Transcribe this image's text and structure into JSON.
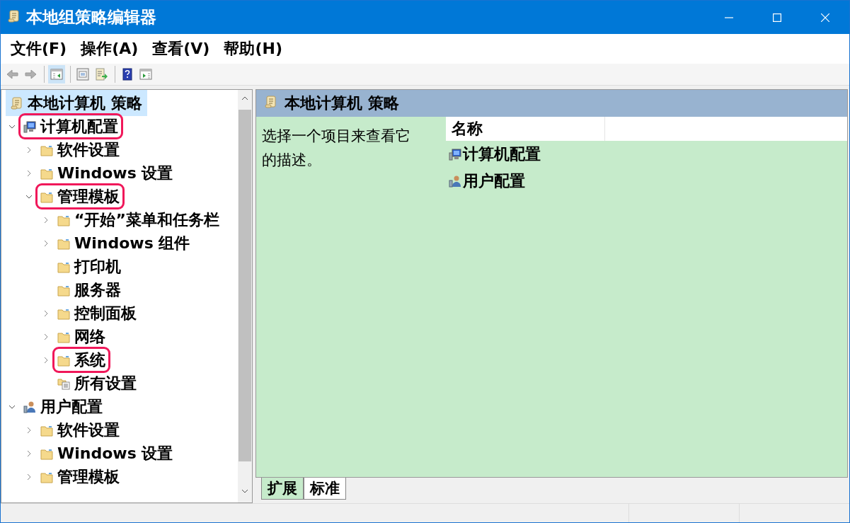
{
  "window": {
    "title": "本地组策略编辑器"
  },
  "menu": [
    "文件(F)",
    "操作(A)",
    "查看(V)",
    "帮助(H)"
  ],
  "toolbar": [
    {
      "kind": "back",
      "disabled": true
    },
    {
      "kind": "forward",
      "disabled": true
    },
    {
      "kind": "sep"
    },
    {
      "kind": "tree",
      "selected": true
    },
    {
      "kind": "sep"
    },
    {
      "kind": "properties",
      "selected": false
    },
    {
      "kind": "export",
      "selected": false
    },
    {
      "kind": "sep"
    },
    {
      "kind": "help",
      "selected": false
    },
    {
      "kind": "pane",
      "selected": false
    }
  ],
  "tree": [
    {
      "label": "本地计算机 策略",
      "kind": "root",
      "selected": true,
      "highlighted": false,
      "children": [
        {
          "label": "计算机配置",
          "kind": "computer",
          "selected": false,
          "highlighted": true,
          "expanded": true,
          "children": [
            {
              "label": "软件设置",
              "kind": "folder",
              "selected": false,
              "highlighted": false,
              "expanded": false
            },
            {
              "label": "Windows 设置",
              "kind": "folder",
              "selected": false,
              "highlighted": false,
              "expanded": false
            },
            {
              "label": "管理模板",
              "kind": "folder",
              "selected": false,
              "highlighted": true,
              "expanded": true,
              "children": [
                {
                  "label": "“开始”菜单和任务栏",
                  "kind": "folder",
                  "selected": false,
                  "highlighted": false,
                  "expanded": false
                },
                {
                  "label": "Windows 组件",
                  "kind": "folder",
                  "selected": false,
                  "highlighted": false,
                  "expanded": false
                },
                {
                  "label": "打印机",
                  "kind": "folder",
                  "selected": false,
                  "highlighted": false
                },
                {
                  "label": "服务器",
                  "kind": "folder",
                  "selected": false,
                  "highlighted": false
                },
                {
                  "label": "控制面板",
                  "kind": "folder",
                  "selected": false,
                  "highlighted": false,
                  "expanded": false
                },
                {
                  "label": "网络",
                  "kind": "folder",
                  "selected": false,
                  "highlighted": false,
                  "expanded": false
                },
                {
                  "label": "系统",
                  "kind": "folder",
                  "selected": false,
                  "highlighted": true,
                  "expanded": false
                },
                {
                  "label": "所有设置",
                  "kind": "settings",
                  "selected": false,
                  "highlighted": false
                }
              ]
            }
          ]
        },
        {
          "label": "用户配置",
          "kind": "user",
          "selected": false,
          "highlighted": false,
          "expanded": true,
          "children": [
            {
              "label": "软件设置",
              "kind": "folder",
              "selected": false,
              "highlighted": false,
              "expanded": false
            },
            {
              "label": "Windows 设置",
              "kind": "folder",
              "selected": false,
              "highlighted": false,
              "expanded": false
            },
            {
              "label": "管理模板",
              "kind": "folder",
              "selected": false,
              "highlighted": false,
              "expanded": false
            }
          ]
        }
      ]
    }
  ],
  "detail": {
    "title": "本地计算机 策略",
    "description": "选择一个项目来查看它的描述。",
    "columns": [
      "名称"
    ],
    "items": [
      {
        "label": "计算机配置",
        "kind": "computer"
      },
      {
        "label": "用户配置",
        "kind": "user"
      }
    ]
  },
  "view_tabs": [
    {
      "label": "扩展",
      "selected": true
    },
    {
      "label": "标准",
      "selected": false
    }
  ]
}
